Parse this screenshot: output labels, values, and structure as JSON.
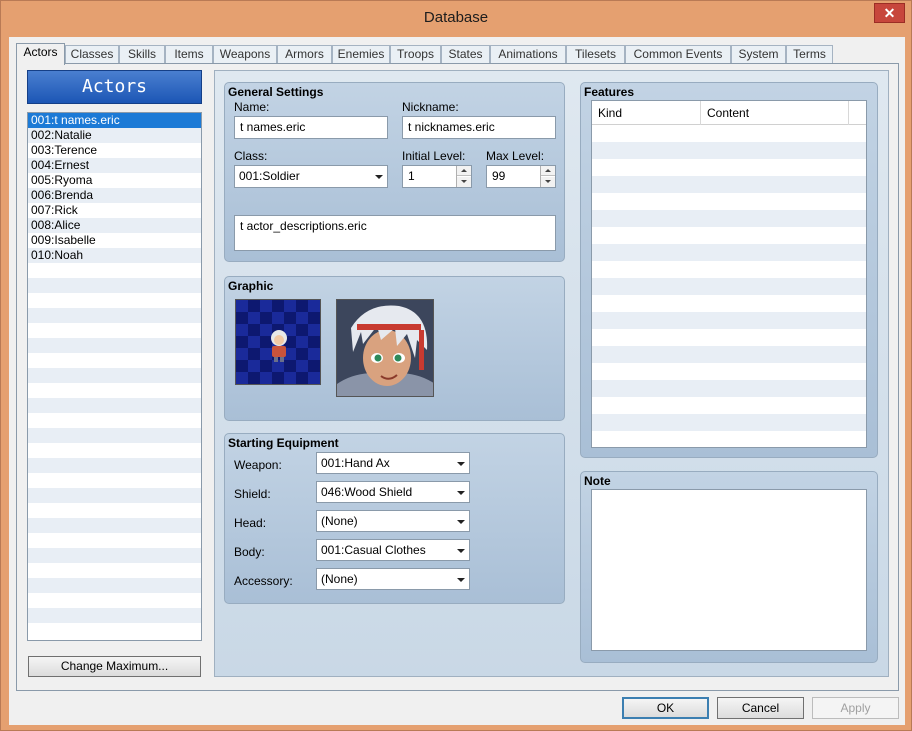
{
  "window": {
    "title": "Database",
    "close_label": "✕"
  },
  "tabs": [
    {
      "label": "Actors",
      "active": true
    },
    {
      "label": "Classes"
    },
    {
      "label": "Skills"
    },
    {
      "label": "Items"
    },
    {
      "label": "Weapons"
    },
    {
      "label": "Armors"
    },
    {
      "label": "Enemies"
    },
    {
      "label": "Troops"
    },
    {
      "label": "States"
    },
    {
      "label": "Animations"
    },
    {
      "label": "Tilesets"
    },
    {
      "label": "Common Events"
    },
    {
      "label": "System"
    },
    {
      "label": "Terms"
    }
  ],
  "actors_panel": {
    "header": "Actors",
    "selected_index": 0,
    "items": [
      "001:t names.eric",
      "002:Natalie",
      "003:Terence",
      "004:Ernest",
      "005:Ryoma",
      "006:Brenda",
      "007:Rick",
      "008:Alice",
      "009:Isabelle",
      "010:Noah"
    ],
    "change_max_label": "Change Maximum..."
  },
  "general": {
    "title": "General Settings",
    "name_label": "Name:",
    "name_value": "t names.eric",
    "nickname_label": "Nickname:",
    "nickname_value": "t nicknames.eric",
    "class_label": "Class:",
    "class_value": "001:Soldier",
    "initial_level_label": "Initial Level:",
    "initial_level_value": "1",
    "max_level_label": "Max Level:",
    "max_level_value": "99",
    "description_value": "t actor_descriptions.eric"
  },
  "graphic": {
    "title": "Graphic"
  },
  "equipment": {
    "title": "Starting Equipment",
    "slots": [
      {
        "label": "Weapon:",
        "value": "001:Hand Ax"
      },
      {
        "label": "Shield:",
        "value": "046:Wood Shield"
      },
      {
        "label": "Head:",
        "value": "(None)"
      },
      {
        "label": "Body:",
        "value": "001:Casual Clothes"
      },
      {
        "label": "Accessory:",
        "value": "(None)"
      }
    ]
  },
  "features": {
    "title": "Features",
    "columns": [
      "Kind",
      "Content"
    ]
  },
  "note": {
    "title": "Note"
  },
  "buttons": {
    "ok": "OK",
    "cancel": "Cancel",
    "apply": "Apply"
  },
  "colors": {
    "frame": "#e5a070",
    "selection": "#1c7ad6",
    "header_gradient_top": "#4a7fd0",
    "header_gradient_bottom": "#1c56b5"
  }
}
